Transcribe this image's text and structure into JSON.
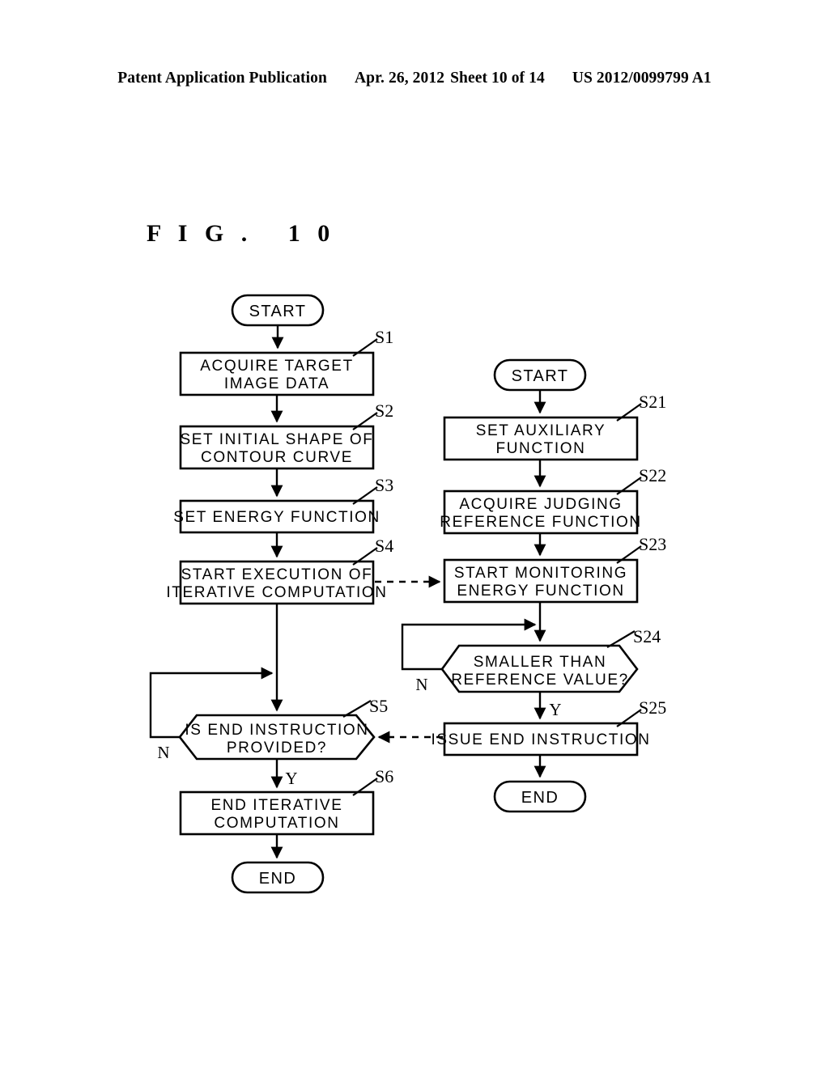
{
  "header": {
    "publication": "Patent Application Publication",
    "date": "Apr. 26, 2012",
    "sheet": "Sheet 10 of 14",
    "document_number": "US 2012/0099799 A1"
  },
  "figure": {
    "title": "F I G .   1 0"
  },
  "flowchart": {
    "left_process": {
      "start": {
        "label": "START"
      },
      "steps": [
        {
          "step": "S1",
          "line1": "ACQUIRE TARGET",
          "line2": "IMAGE DATA"
        },
        {
          "step": "S2",
          "line1": "SET INITIAL SHAPE OF",
          "line2": "CONTOUR CURVE"
        },
        {
          "step": "S3",
          "line1": "SET ENERGY FUNCTION",
          "line2": ""
        },
        {
          "step": "S4",
          "line1": "START EXECUTION OF",
          "line2": "ITERATIVE COMPUTATION"
        },
        {
          "step": "S5",
          "line1": "IS END INSTRUCTION",
          "line2": "PROVIDED?"
        },
        {
          "step": "S6",
          "line1": "END ITERATIVE",
          "line2": "COMPUTATION"
        }
      ],
      "decision_branches": {
        "no": "N",
        "yes": "Y"
      },
      "end": {
        "label": "END"
      }
    },
    "right_process": {
      "start": {
        "label": "START"
      },
      "steps": [
        {
          "step": "S21",
          "line1": "SET AUXILIARY",
          "line2": "FUNCTION"
        },
        {
          "step": "S22",
          "line1": "ACQUIRE JUDGING",
          "line2": "REFERENCE FUNCTION"
        },
        {
          "step": "S23",
          "line1": "START MONITORING",
          "line2": "ENERGY FUNCTION"
        },
        {
          "step": "S24",
          "line1": "SMALLER THAN",
          "line2": "REFERENCE VALUE?"
        },
        {
          "step": "S25",
          "line1": "ISSUE END INSTRUCTION",
          "line2": ""
        }
      ],
      "decision_branches": {
        "no": "N",
        "yes": "Y"
      },
      "end": {
        "label": "END"
      }
    }
  }
}
